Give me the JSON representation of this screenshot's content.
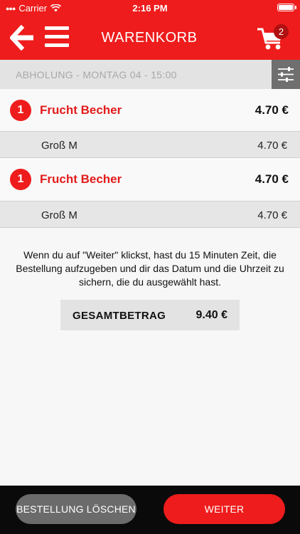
{
  "status": {
    "carrier": "Carrier",
    "time": "2:16 PM"
  },
  "header": {
    "title": "WARENKORB",
    "cart_count": "2"
  },
  "pickup": {
    "label": "ABHOLUNG - MONTAG 04 - 15:00"
  },
  "cart_items": [
    {
      "qty": "1",
      "name": "Frucht Becher",
      "price": "4.70 €",
      "option": "Groß M",
      "option_price": "4.70 €"
    },
    {
      "qty": "1",
      "name": "Frucht Becher",
      "price": "4.70 €",
      "option": "Groß M",
      "option_price": "4.70 €"
    }
  ],
  "info_text": "Wenn du auf \"Weiter\" klickst, hast du 15 Minuten Zeit, die Bestellung aufzugeben und dir das Datum und die Uhrzeit zu sichern, die du ausgewählt hast.",
  "total": {
    "label": "GESAMTBETRAG",
    "value": "9.40 €"
  },
  "footer": {
    "delete_label": "BESTELLUNG LÖSCHEN",
    "next_label": "WEITER"
  },
  "colors": {
    "brand_red": "#ee1c1c",
    "dark_red": "#b01010",
    "grey_button": "#6b6b6b",
    "footer_bg": "#0a0a0a"
  },
  "icons": [
    "wifi-icon",
    "battery-icon",
    "back-arrow-icon",
    "hamburger-menu-icon",
    "cart-icon",
    "filter-sliders-icon"
  ]
}
